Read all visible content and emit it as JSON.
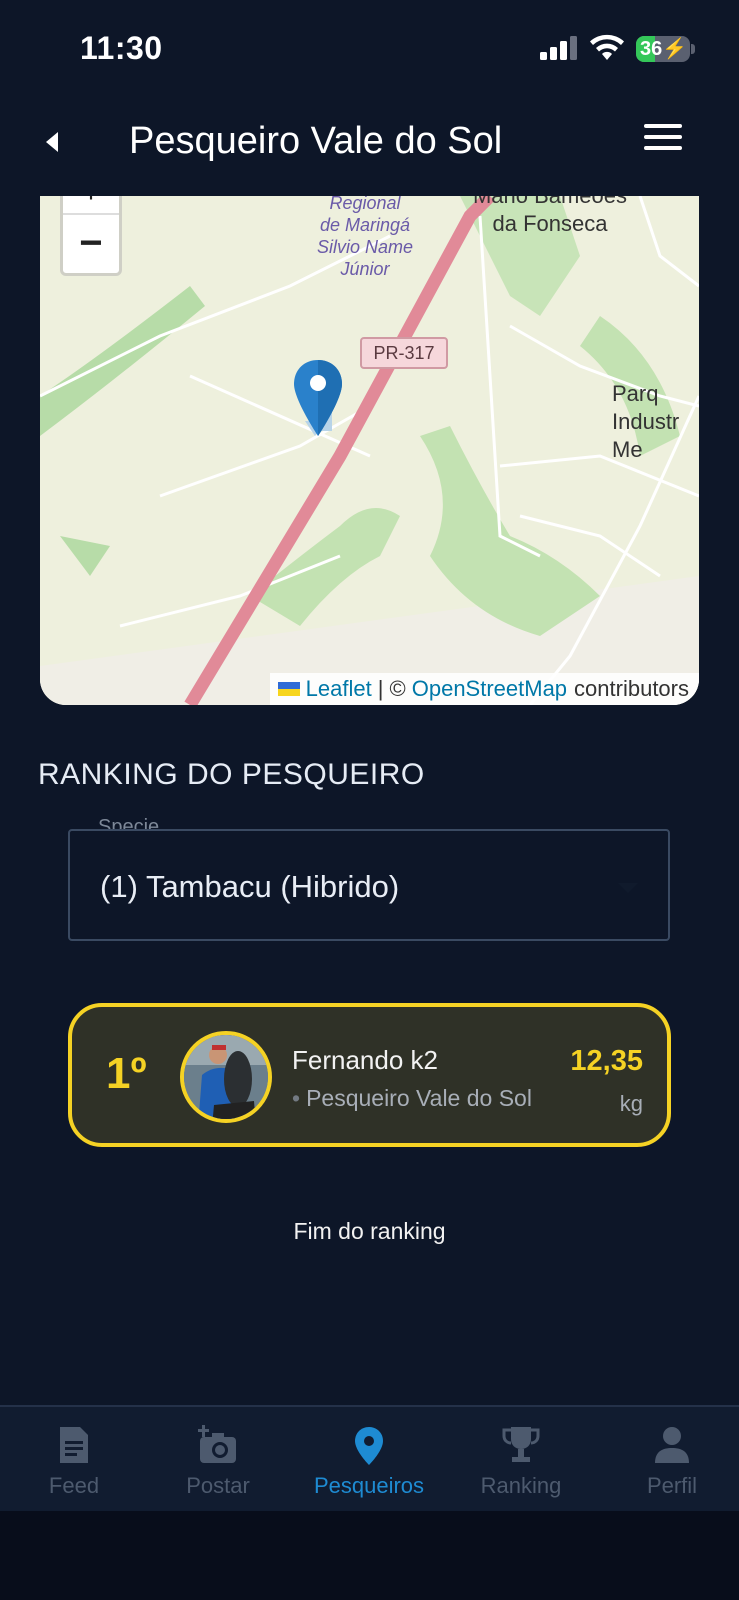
{
  "status_bar": {
    "time": "11:30",
    "battery": "36",
    "battery_level": 36
  },
  "header": {
    "title": "Pesqueiro Vale do Sol",
    "back_icon": "chevron-left-icon",
    "menu_icon": "hamburger-menu-icon"
  },
  "map": {
    "zoom_in": "+",
    "zoom_out": "−",
    "labels": {
      "regional": "Regional\nde Maringá\nSilvio Name\nJúnior",
      "fonseca": "Mario Bameoes\nda Fonseca",
      "parque": "Parq\nIndustr\nMe"
    },
    "road_shield": "PR-317",
    "attribution": {
      "leaflet": "Leaflet",
      "separator": "| ©",
      "osm": "OpenStreetMap",
      "contributors": "contributors"
    }
  },
  "ranking": {
    "section_title": "RANKING DO PESQUEIRO",
    "species_select": {
      "label": "Specie",
      "value": "(1) Tambacu (Hibrido)"
    },
    "entries": [
      {
        "position": "1º",
        "name": "Fernando k2",
        "place": "Pesqueiro Vale do Sol",
        "weight": "12,35",
        "unit": "kg"
      }
    ],
    "end_text": "Fim do ranking"
  },
  "nav": {
    "items": [
      {
        "label": "Feed",
        "icon": "document-icon"
      },
      {
        "label": "Postar",
        "icon": "add-camera-icon"
      },
      {
        "label": "Pesqueiros",
        "icon": "map-pin-icon",
        "active": true
      },
      {
        "label": "Ranking",
        "icon": "trophy-icon"
      },
      {
        "label": "Perfil",
        "icon": "person-icon"
      }
    ]
  },
  "colors": {
    "background": "#0d1628",
    "accent_gold": "#f5d224",
    "active_blue": "#1e8bd2"
  }
}
